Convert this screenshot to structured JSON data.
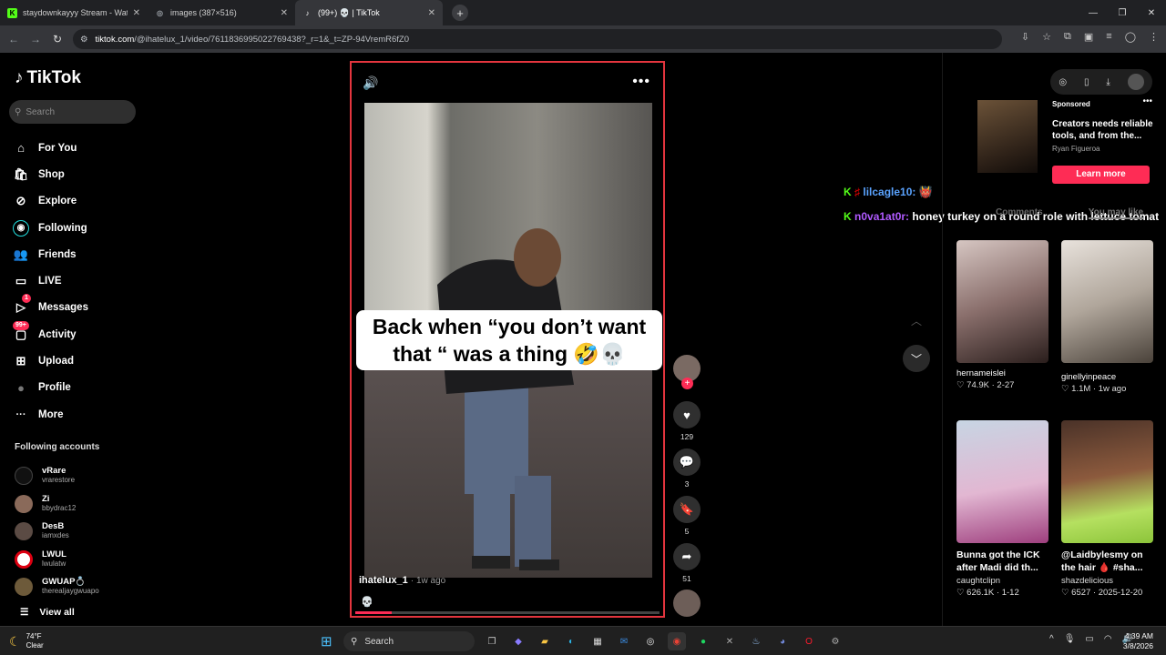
{
  "browser": {
    "tabs": [
      {
        "title": "staydownkayyy Stream - Watch",
        "favicon": "K",
        "color": "#53fc18"
      },
      {
        "title": "images (387×516)",
        "favicon": "◎",
        "color": "#9aa0a6"
      },
      {
        "title": "(99+) 💀 | TikTok",
        "favicon": "♪",
        "color": "#ffffff"
      }
    ],
    "url_host": "tiktok.com",
    "url_path": "/@ihatelux_1/video/7611836995022769438?_r=1&_t=ZP-94VremR6fZ0"
  },
  "sidebar": {
    "logo": "TikTok",
    "search_placeholder": "Search",
    "nav": [
      {
        "label": "For You",
        "icon": "⌂"
      },
      {
        "label": "Shop",
        "icon": "🛍"
      },
      {
        "label": "Explore",
        "icon": "⊘"
      },
      {
        "label": "Following",
        "icon": "◉"
      },
      {
        "label": "Friends",
        "icon": "👥"
      },
      {
        "label": "LIVE",
        "icon": "▭"
      },
      {
        "label": "Messages",
        "icon": "▷",
        "badge": "1"
      },
      {
        "label": "Activity",
        "icon": "▢",
        "badge": "99+"
      },
      {
        "label": "Upload",
        "icon": "⊞"
      },
      {
        "label": "Profile",
        "icon": "●"
      },
      {
        "label": "More",
        "icon": "···"
      }
    ],
    "following_heading": "Following accounts",
    "following": [
      {
        "name": "vRare",
        "handle": "vrarestore"
      },
      {
        "name": "Zi",
        "handle": "bbydrac12"
      },
      {
        "name": "DesB",
        "handle": "iamxdes"
      },
      {
        "name": "LWUL",
        "handle": "lwulatw"
      },
      {
        "name": "GWUAP💍",
        "handle": "therealjaygwuapo"
      }
    ],
    "view_all": "View all"
  },
  "video": {
    "caption_line1": "Back when “you don’t want",
    "caption_line2": "that “ was a thing 🤣💀",
    "author": "ihatelux_1",
    "time": "· 1w ago",
    "description": "💀",
    "progress": 0.12
  },
  "actions": {
    "likes": "129",
    "comments": "3",
    "saves": "5",
    "shares": "51"
  },
  "chat": [
    {
      "user": "lilcagle10:",
      "msg": "👹",
      "color": "#5aa3ff"
    },
    {
      "user": "n0va1at0r:",
      "msg": "honey turkey on a round role with lettuce tomat",
      "color": "#b05aff"
    }
  ],
  "ad": {
    "sponsored": "Sponsored",
    "title": "Creators needs reliable tools, and from the...",
    "author": "Ryan Figueroa",
    "button": "Learn more"
  },
  "rtabs": [
    "Comments",
    "You may like"
  ],
  "cards": [
    {
      "name": "hernameislei",
      "stats": "♡ 74.9K · 2-27",
      "c1": "#c4b0ae",
      "c2": "#3c2a28"
    },
    {
      "name": "ginellyinpeace",
      "stats": "♡ 1.1M · 1w ago",
      "c1": "#d9d2cb",
      "c2": "#7a6e64"
    },
    {
      "name": "Bunna got the ICK after Madi did th...",
      "user": "caughtclipn",
      "stats": "♡ 626.1K · 1-12",
      "c1": "#9fb3c7",
      "c2": "#c46aa0",
      "bold": true
    },
    {
      "name": "@Laidbylesmy on the hair 🩸 #sha...",
      "user": "shazdelicious",
      "stats": "♡ 6527 · 2025-12-20",
      "c1": "#5e3a2b",
      "c2": "#a9d94a",
      "bold": true
    }
  ],
  "taskbar": {
    "temp": "74°F",
    "weather": "Clear",
    "search": "Search",
    "time": "4:39 AM",
    "date": "3/8/2026"
  }
}
